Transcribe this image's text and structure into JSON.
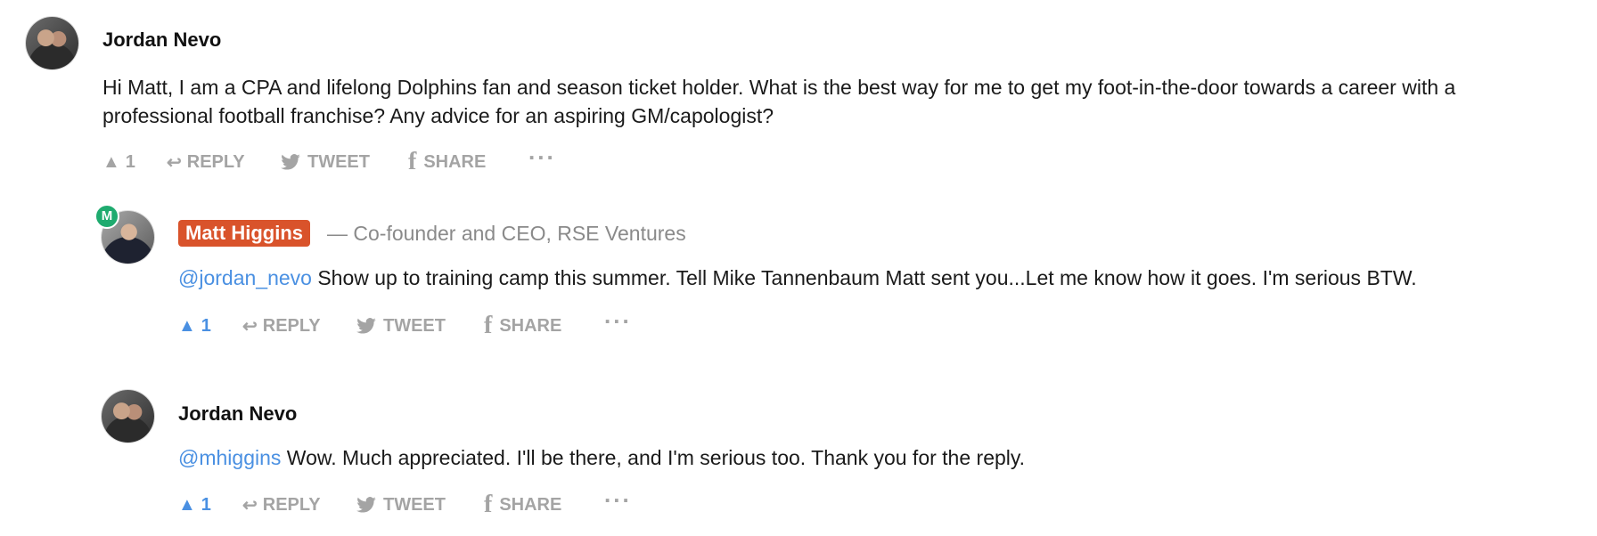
{
  "comments": [
    {
      "author": "Jordan Nevo",
      "text": "Hi Matt, I am a CPA and lifelong Dolphins fan and season ticket holder. What is the best way for me to get my foot-in-the-door towards a career with a",
      "text2": "professional football franchise? Any advice for an aspiring GM/capologist?",
      "upvotes": "1",
      "reply_label": "REPLY",
      "tweet_label": "TWEET",
      "share_label": "SHARE",
      "more_label": "..."
    },
    {
      "author": "Matt Higgins",
      "badge": "M",
      "role": "— Co-founder and CEO, RSE Ventures",
      "mention": "@jordan_nevo",
      "text": " Show up to training camp this summer. Tell Mike Tannenbaum Matt sent you...Let me know how it goes. I'm serious BTW.",
      "upvotes": "1",
      "reply_label": "REPLY",
      "tweet_label": "TWEET",
      "share_label": "SHARE",
      "more_label": "..."
    },
    {
      "author": "Jordan Nevo",
      "mention": "@mhiggins",
      "text": " Wow. Much appreciated. I'll be there, and I'm serious too. Thank you for the reply.",
      "upvotes": "1",
      "reply_label": "REPLY",
      "tweet_label": "TWEET",
      "share_label": "SHARE",
      "more_label": "..."
    }
  ],
  "colors": {
    "accent": "#4a90e2",
    "name_tag": "#d9532b",
    "badge": "#1fab6f",
    "action_gray": "#a4a4a4"
  },
  "icons": {
    "upvote": "upvote-triangle-icon",
    "reply": "reply-arrow-icon",
    "tweet": "twitter-bird-icon",
    "share": "facebook-f-icon",
    "more": "ellipsis-icon"
  }
}
